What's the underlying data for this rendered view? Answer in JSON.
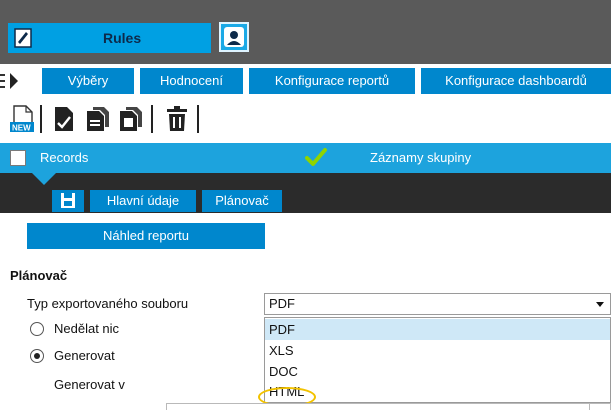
{
  "header": {
    "app_title": "Rules",
    "app_icon": "app-icon",
    "user_icon": "user-icon",
    "colors": {
      "topbar": "#5a5a5a",
      "accent": "#00a0e3",
      "nav": "#0087cd"
    }
  },
  "nav": {
    "items": [
      {
        "label": "Výběry"
      },
      {
        "label": "Hodnocení"
      },
      {
        "label": "Konfigurace reportů"
      },
      {
        "label": "Konfigurace dashboardů"
      }
    ]
  },
  "toolbar": {
    "new_icon_label": "NEW",
    "icons": [
      "new-record-icon",
      "edit-icon",
      "copy-icon",
      "archive-icon",
      "delete-icon"
    ]
  },
  "records_bar": {
    "records_label": "Records",
    "group_label": "Záznamy skupiny",
    "checked": false
  },
  "tabs": {
    "items": [
      {
        "label": "Hlavní údaje"
      },
      {
        "label": "Plánovač"
      }
    ]
  },
  "content": {
    "preview_button": "Náhled reportu",
    "section_title": "Plánovač",
    "export_type_label": "Typ exportovaného souboru",
    "export_type_value": "PDF",
    "radio_do_nothing": "Nedělat nic",
    "radio_generate": "Generovat",
    "radio_selected": "Generovat",
    "generate_in_label": "Generovat v",
    "options": [
      "PDF",
      "XLS",
      "DOC",
      "HTML"
    ],
    "selected_option": "PDF",
    "highlighted_option": "HTML"
  }
}
